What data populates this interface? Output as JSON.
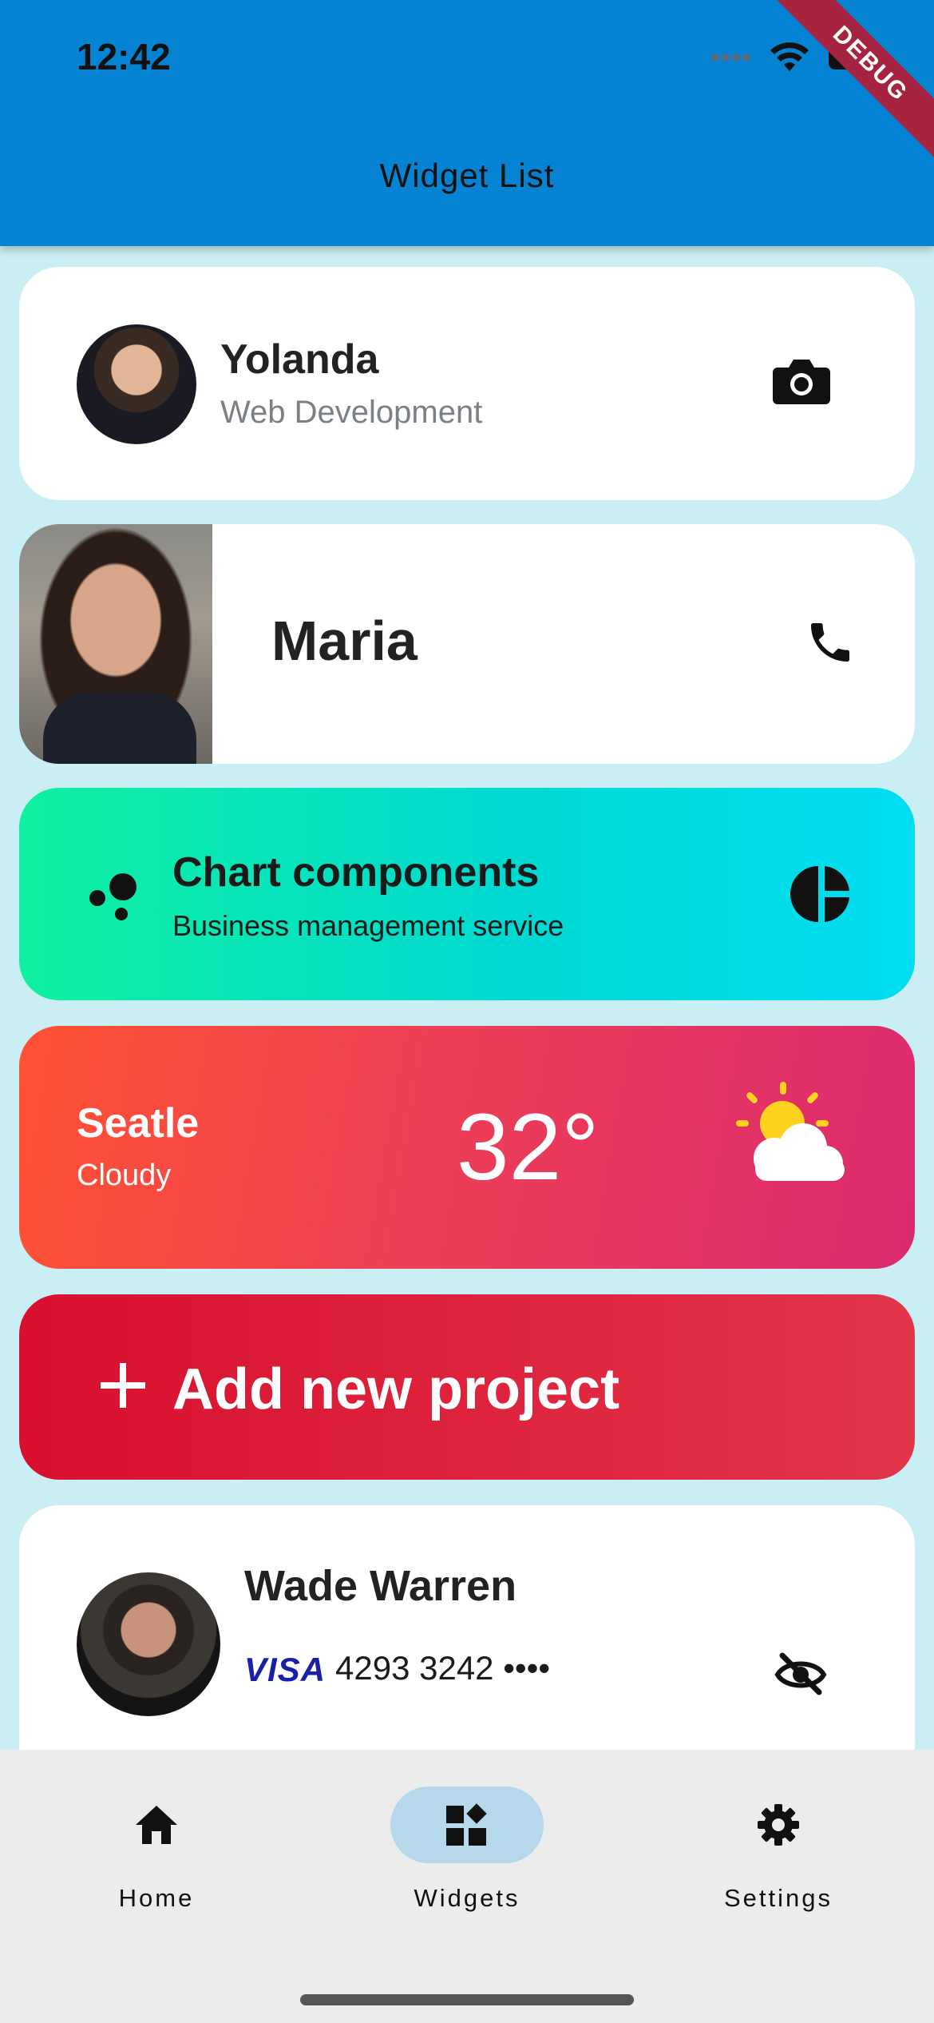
{
  "status_bar": {
    "time": "12:42",
    "debug_label": "DEBUG"
  },
  "appbar": {
    "title": "Widget List",
    "color": "#0583d2"
  },
  "cards": {
    "yolanda": {
      "name": "Yolanda",
      "role": "Web Development",
      "action_icon": "camera-icon"
    },
    "maria": {
      "name": "Maria",
      "action_icon": "phone-icon"
    },
    "chart": {
      "title": "Chart components",
      "subtitle": "Business management service",
      "left_icon": "bubble-chart-icon",
      "right_icon": "pie-chart-icon"
    },
    "weather": {
      "city": "Seatle",
      "condition": "Cloudy",
      "temperature": "32°",
      "icon": "partly-sunny-icon"
    },
    "add_project": {
      "label": "Add new project",
      "icon": "plus-icon"
    },
    "wade": {
      "name": "Wade Warren",
      "card_brand": "VISA",
      "card_number": "4293 3242 ••••",
      "action_icon": "eye-off-icon"
    }
  },
  "bottom_nav": {
    "items": [
      {
        "label": "Home",
        "icon": "home-icon",
        "selected": false
      },
      {
        "label": "Widgets",
        "icon": "widgets-icon",
        "selected": true
      },
      {
        "label": "Settings",
        "icon": "gear-icon",
        "selected": false
      }
    ],
    "selected_color": "#b7d8ea"
  }
}
